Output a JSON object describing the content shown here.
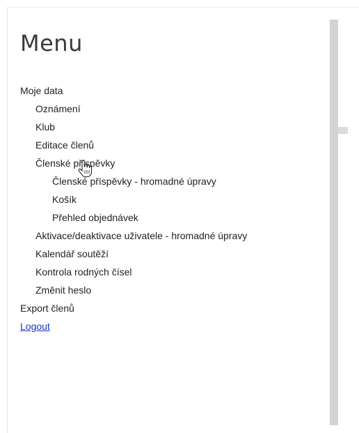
{
  "menu": {
    "title": "Menu",
    "items": [
      {
        "label": "Moje data",
        "level": 1,
        "link": false
      },
      {
        "label": "Oznámení",
        "level": 2,
        "link": false
      },
      {
        "label": "Klub",
        "level": 2,
        "link": false
      },
      {
        "label": "Editace členů",
        "level": 2,
        "link": false
      },
      {
        "label": "Členské příspěvky",
        "level": 2,
        "link": false
      },
      {
        "label": "Členské příspěvky - hromadné úpravy",
        "level": 3,
        "link": false
      },
      {
        "label": "Košík",
        "level": 3,
        "link": false
      },
      {
        "label": "Přehled objednávek",
        "level": 3,
        "link": false
      },
      {
        "label": "Aktivace/deaktivace uživatele - hromadné úpravy",
        "level": 2,
        "link": false
      },
      {
        "label": "Kalendář soutěží",
        "level": 2,
        "link": false
      },
      {
        "label": "Kontrola rodných čísel",
        "level": 2,
        "link": false
      },
      {
        "label": "Změnit heslo",
        "level": 2,
        "link": false
      },
      {
        "label": "Export členů",
        "level": 1,
        "link": false
      },
      {
        "label": "Logout",
        "level": 1,
        "link": true
      }
    ]
  },
  "colors": {
    "text": "#222222",
    "link": "#1a33c8",
    "scrollbar": "#d4d4d4"
  },
  "cursor": {
    "icon": "hand-pointer-icon"
  }
}
